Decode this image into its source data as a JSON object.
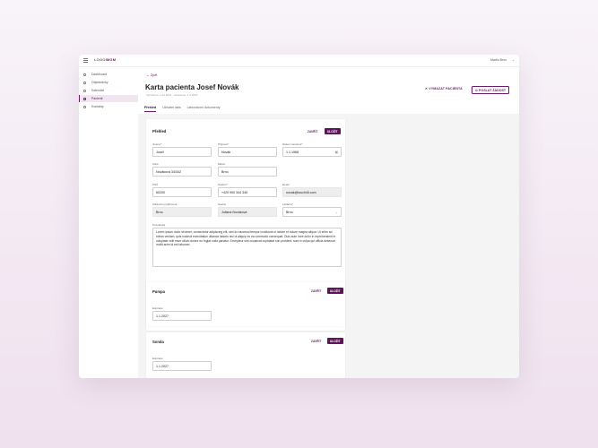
{
  "topbar": {
    "logo_prefix": "LOGO",
    "logo_brand": "IMGM",
    "user": "Martin Brno",
    "user_chevron": "⌄"
  },
  "sidebar": {
    "items": [
      {
        "label": "Dashboard",
        "active": false
      },
      {
        "label": "Objednávky",
        "active": false
      },
      {
        "label": "Kalendář",
        "active": false
      },
      {
        "label": "Pacienti",
        "active": true
      },
      {
        "label": "Kontakty",
        "active": false
      }
    ]
  },
  "header": {
    "back": "Zpět",
    "title": "Karta pacienta Josef Novák",
    "subtitle": "Vytvořeno: 1.12.2021 · Upraveno: 1.1.2022",
    "delete_button": "VYMAZAT PACIENTA",
    "send_button": "POSLAT ŽÁDOST"
  },
  "tabs": [
    "Přehled",
    "Uživatel labs",
    "Laboratorní dokumenty"
  ],
  "overview": {
    "title": "Přehled",
    "close": "ZAVŘÍT",
    "save": "ULOŽIT",
    "fields": {
      "first_name": {
        "label": "Jméno*",
        "value": "Josef"
      },
      "last_name": {
        "label": "Příjmení*",
        "value": "Novák"
      },
      "birth_date": {
        "label": "Datum narození*",
        "value": "1.1.1968"
      },
      "street": {
        "label": "Ulice",
        "value": "Nováková 34/342"
      },
      "city": {
        "label": "Město",
        "value": "Brno"
      },
      "zip": {
        "label": "PSČ",
        "value": "60200"
      },
      "phone": {
        "label": "Telefon*",
        "value": "+420 900 344 345"
      },
      "email": {
        "label": "Email",
        "value": "novak@touch4it.com"
      },
      "insurance": {
        "label": "Zdravotní pojišťovna",
        "value": "Brno"
      },
      "nurse": {
        "label": "Sestra",
        "value": "Juliana Nováková"
      },
      "doctor": {
        "label": "Lékárna*",
        "value": "Brno"
      },
      "note": {
        "label": "Poznámka",
        "value": "Lorem ipsum dolor sit amet, consectetur adipiscing elit, sed do eiusmod tempor incididunt ut labore et dolore magna aliqua. Ut enim ad minim veniam, quis nostrud exercitation ullamco laboris nisi ut aliquip ex ea commodo consequat. Duis aute irure dolor in reprehenderit in voluptate velit esse cillum dolore eu fugiat nulla pariatur. Excepteur sint occaecat cupidatat non proident, sunt in culpa qui officia deserunt mollit anim id est laborum."
      }
    }
  },
  "pumpa": {
    "title": "Pumpa",
    "close": "ZAVŘÍT",
    "save": "ULOŽIT",
    "expiry_label": "Expirace",
    "expiry_value": "1.1.2027"
  },
  "sonda": {
    "title": "Sonda",
    "close": "ZAVŘÍT",
    "save": "ULOŽIT",
    "expiry_label": "Expirace",
    "expiry_value": "1.1.2027"
  },
  "colors": {
    "accent": "#6e1b6e",
    "save_bg": "#5c1559"
  },
  "icons": {
    "calendar": "calendar-icon",
    "chevron": "chevron-down-icon",
    "back": "arrow-left-icon",
    "delete": "close-icon",
    "send": "send-icon"
  }
}
